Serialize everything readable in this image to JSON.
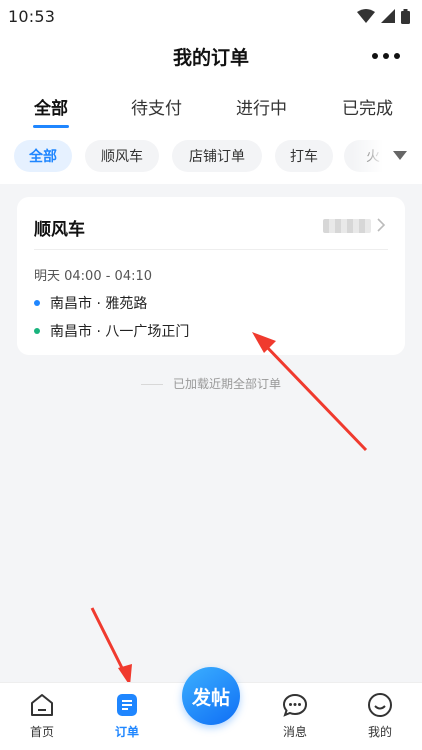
{
  "statusbar": {
    "time": "10:53"
  },
  "header": {
    "title": "我的订单"
  },
  "tabs": [
    {
      "label": "全部",
      "active": true
    },
    {
      "label": "待支付"
    },
    {
      "label": "进行中"
    },
    {
      "label": "已完成"
    }
  ],
  "chips": [
    {
      "label": "全部",
      "active": true
    },
    {
      "label": "顺风车"
    },
    {
      "label": "店铺订单"
    },
    {
      "label": "打车"
    },
    {
      "label": "火"
    }
  ],
  "order": {
    "type": "顺风车",
    "time": "明天 04:00 - 04:10",
    "from": "南昌市 · 雅苑路",
    "to": "南昌市 · 八一广场正门"
  },
  "list_footer": "已加载近期全部订单",
  "bottomnav": {
    "home": "首页",
    "orders": "订单",
    "post": "发帖",
    "messages": "消息",
    "mine": "我的"
  },
  "colors": {
    "accent": "#1f86ff",
    "origin_dot": "#1f86ff",
    "destination_dot": "#19b37d",
    "annotation_arrow": "#f03a2e"
  }
}
